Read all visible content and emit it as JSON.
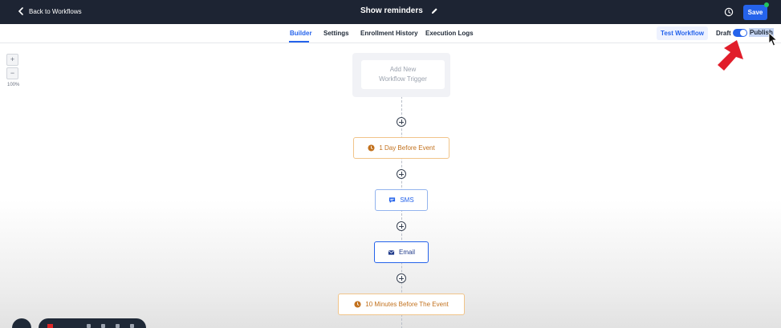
{
  "header": {
    "back_label": "Back to Workflows",
    "title": "Show reminders",
    "save_label": "Save"
  },
  "tabs": [
    {
      "label": "Builder",
      "active": true
    },
    {
      "label": "Settings",
      "active": false
    },
    {
      "label": "Enrollment History",
      "active": false
    },
    {
      "label": "Execution Logs",
      "active": false
    }
  ],
  "toolbar": {
    "test_label": "Test Workflow",
    "draft_label": "Draft",
    "publish_label": "Publish",
    "published_toggle_on": true
  },
  "canvas": {
    "zoom_in": "+",
    "zoom_out": "−",
    "zoom_level": "100%",
    "trigger": {
      "line1": "Add New",
      "line2": "Workflow Trigger"
    },
    "steps": [
      {
        "type": "delay",
        "label": "1 Day Before Event",
        "icon": "clock-icon"
      },
      {
        "type": "action",
        "label": "SMS",
        "icon": "chat-bubble-icon"
      },
      {
        "type": "action",
        "label": "Email",
        "icon": "envelope-icon"
      },
      {
        "type": "delay",
        "label": "10 Minutes Before The Event",
        "icon": "clock-icon"
      }
    ]
  },
  "colors": {
    "header_bg": "#1d2433",
    "accent": "#2563eb",
    "delay": "#c2711d",
    "annotation_arrow": "#e11d2a",
    "online_dot": "#22c55e"
  }
}
